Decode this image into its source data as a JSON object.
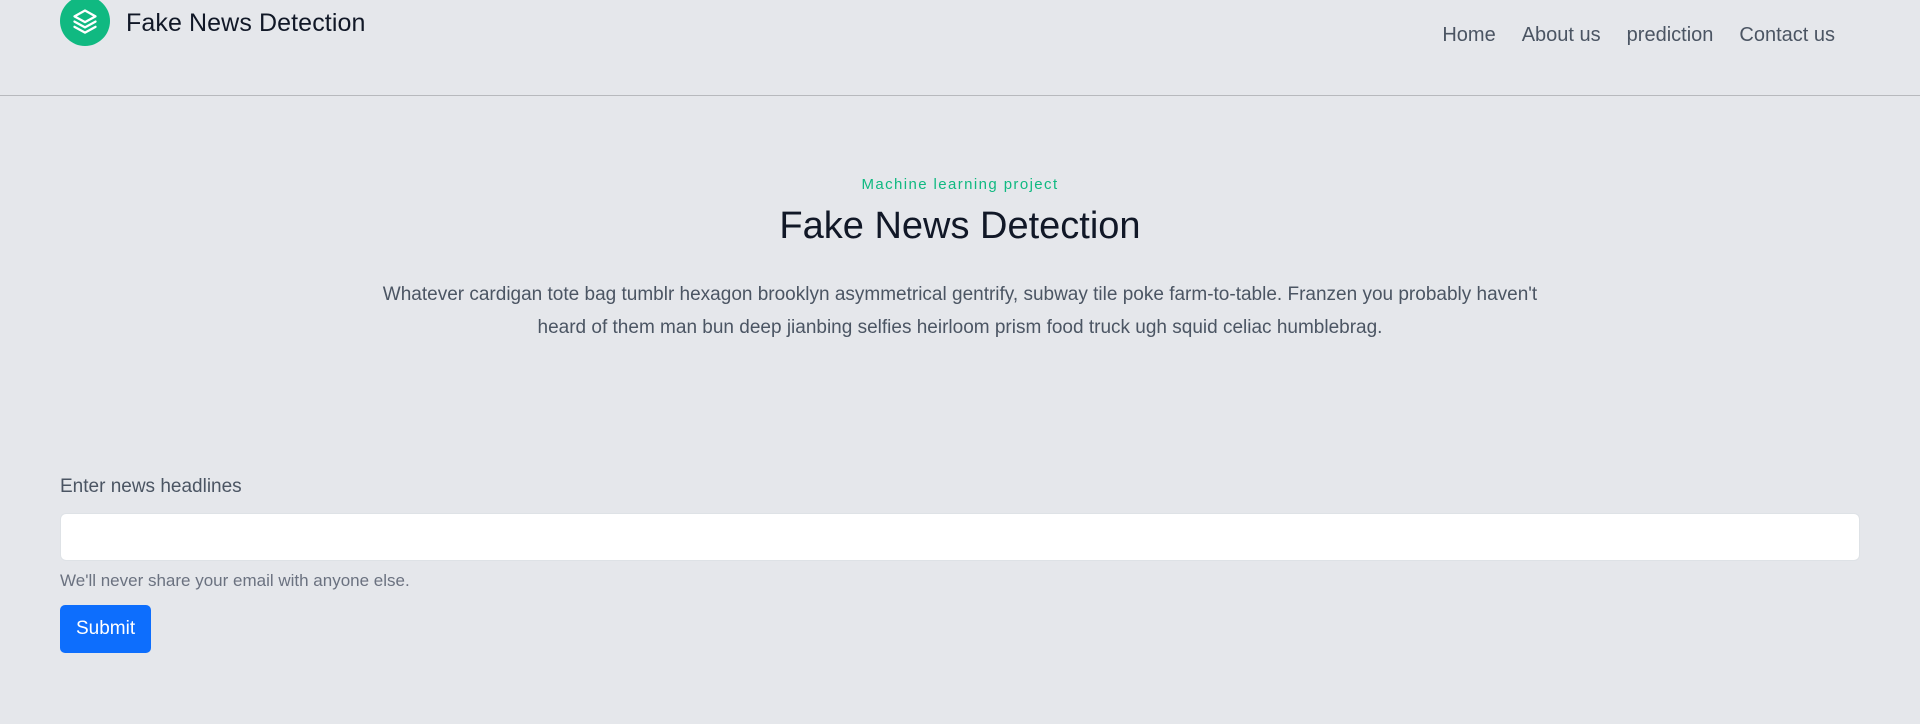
{
  "header": {
    "logo_icon": "stack-layers-icon",
    "brand_title": "Fake News Detection",
    "nav": [
      {
        "label": "Home"
      },
      {
        "label": "About us"
      },
      {
        "label": "prediction"
      },
      {
        "label": "Contact us"
      }
    ]
  },
  "hero": {
    "eyebrow": "Machine learning project",
    "title": "Fake News Detection",
    "description": "Whatever cardigan tote bag tumblr hexagon brooklyn asymmetrical gentrify, subway tile poke farm-to-table. Franzen you probably haven't heard of them man bun deep jianbing selfies heirloom prism food truck ugh squid celiac humblebrag."
  },
  "form": {
    "label": "Enter news headlines",
    "input_value": "",
    "help_text": "We'll never share your email with anyone else.",
    "submit_label": "Submit"
  },
  "colors": {
    "accent": "#10b981",
    "primary_button": "#0d6efd",
    "background": "#e5e7eb"
  }
}
